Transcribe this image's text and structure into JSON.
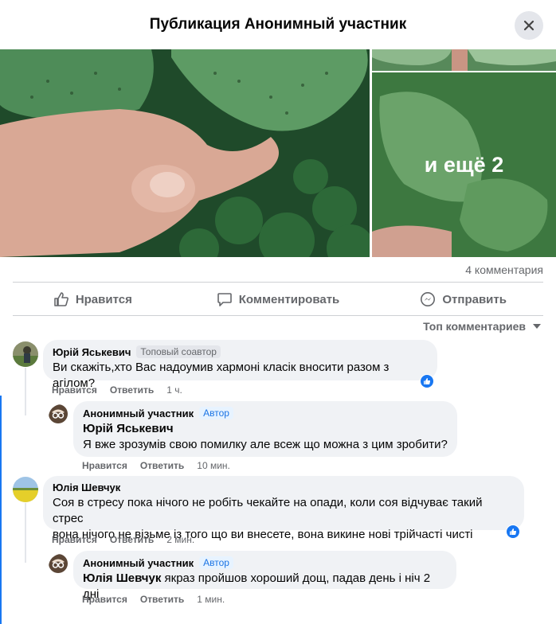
{
  "header": {
    "title": "Публикация Анонимный участник"
  },
  "photos": {
    "more_label": "и ещё 2"
  },
  "stats": {
    "comment_count": "4 комментария"
  },
  "actions": {
    "like": "Нравится",
    "comment": "Комментировать",
    "share": "Отправить"
  },
  "sort": {
    "label": "Топ комментариев"
  },
  "comments": [
    {
      "author": "Юрій Яськевич",
      "badge": "Топовый соавтор",
      "text": "Ви скажіть,хто Вас надоумив хармоні класік вносити разом з агілом?",
      "like": "Нравится",
      "reply": "Ответить",
      "time": "1 ч."
    },
    {
      "author": "Анонимный участник",
      "badge": "Автор",
      "mention": "Юрій Яськевич",
      "text": "Я вже зрозумів свою помилку але всеж що можна з цим зробити?",
      "like": "Нравится",
      "reply": "Ответить",
      "time": "10 мин."
    },
    {
      "author": "Юлія Шевчук",
      "text_line1": "Соя в стресу пока нічого не робіть чекайте на опади, коли соя відчуває такий стрес",
      "text_line2": "вона нічого не візьме із того що ви внесете, вона викине нові трійчасті чисті",
      "like": "Нравится",
      "reply": "Ответить",
      "time": "2 мин."
    },
    {
      "author": "Анонимный участник",
      "badge": "Автор",
      "mention": "Юлія Шевчук",
      "text": "якраз пройшов хороший дощ, падав день і ніч 2 дні",
      "like": "Нравится",
      "reply": "Ответить",
      "time": "1 мин."
    }
  ],
  "colors": {
    "accent": "#1877f2",
    "bubble": "#f0f2f5",
    "muted": "#65676b"
  }
}
